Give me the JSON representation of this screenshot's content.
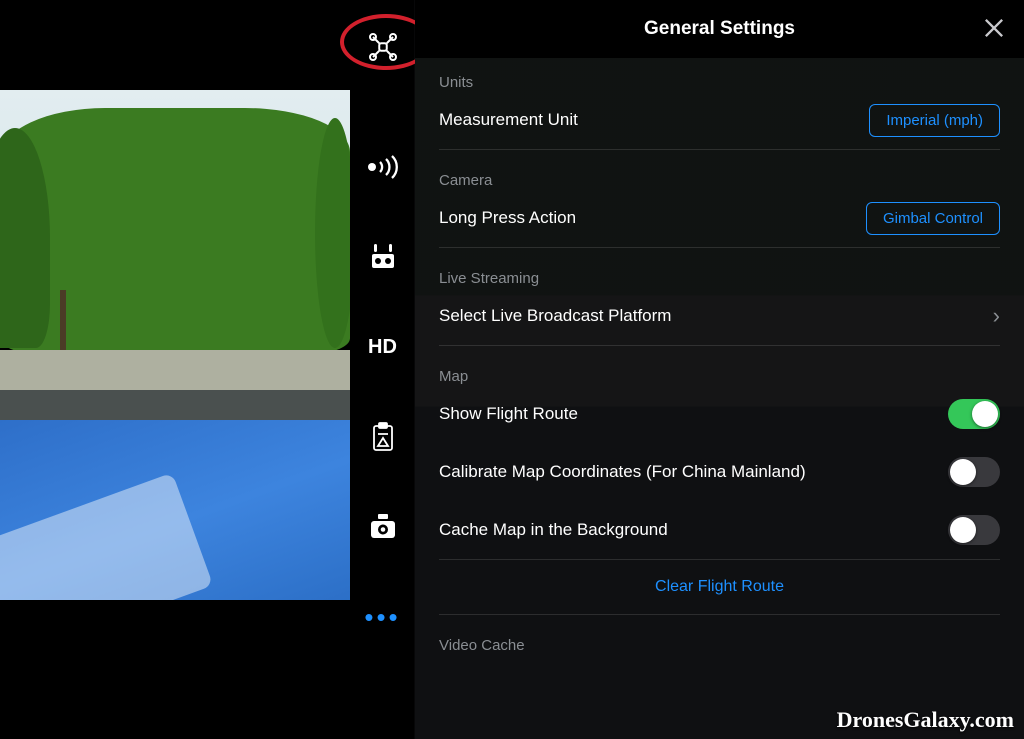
{
  "header": {
    "title": "General Settings"
  },
  "icons": {
    "drone": "drone-icon",
    "signal": "signal-icon",
    "remote": "remote-controller-icon",
    "hd": "HD",
    "battery": "battery-clipboard-icon",
    "gimbal": "gimbal-camera-icon",
    "more": "•••"
  },
  "sections": {
    "units": {
      "label": "Units",
      "measurement": {
        "label": "Measurement Unit",
        "value": "Imperial (mph)"
      }
    },
    "camera": {
      "label": "Camera",
      "longPress": {
        "label": "Long Press Action",
        "value": "Gimbal Control"
      }
    },
    "live": {
      "label": "Live Streaming",
      "platform": {
        "label": "Select Live Broadcast Platform"
      }
    },
    "map": {
      "label": "Map",
      "showRoute": {
        "label": "Show Flight Route",
        "on": true
      },
      "calibrate": {
        "label": "Calibrate Map Coordinates (For China Mainland)",
        "on": false
      },
      "cache": {
        "label": "Cache Map in the Background",
        "on": false
      },
      "clear": {
        "label": "Clear Flight Route"
      }
    },
    "videoCache": {
      "label": "Video Cache"
    }
  },
  "watermark": "DronesGalaxy.com",
  "colors": {
    "accent": "#1e90ff",
    "toggleOn": "#34c759",
    "highlight": "#d2202c"
  }
}
